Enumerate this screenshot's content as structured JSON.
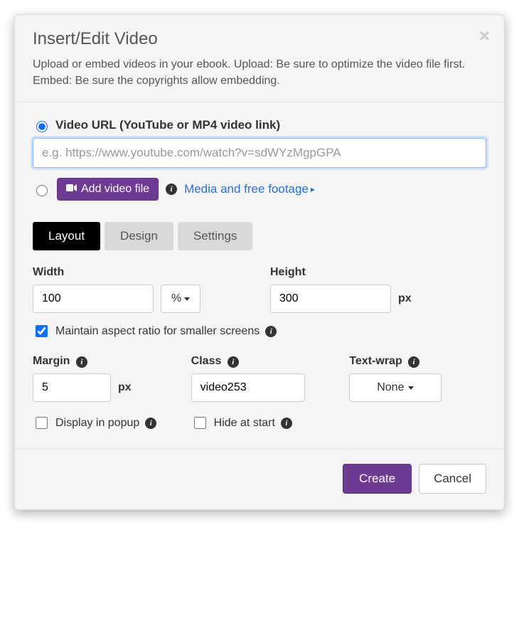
{
  "dialog": {
    "title": "Insert/Edit Video",
    "subtitle": "Upload or embed videos in your ebook. Upload: Be sure to optimize the video file first. Embed: Be sure the copyrights allow embedding."
  },
  "source": {
    "url_option_label": "Video URL (YouTube or MP4 video link)",
    "url_placeholder": "e.g. https://www.youtube.com/watch?v=sdWYzMgpGPA",
    "url_value": "",
    "add_file_label": "Add video file",
    "media_link": "Media and free footage"
  },
  "tabs": {
    "layout": "Layout",
    "design": "Design",
    "settings": "Settings"
  },
  "layout": {
    "width_label": "Width",
    "width_value": "100",
    "width_unit": "%",
    "height_label": "Height",
    "height_value": "300",
    "height_unit": "px",
    "aspect_label": "Maintain aspect ratio for smaller screens",
    "margin_label": "Margin",
    "margin_value": "5",
    "margin_unit": "px",
    "class_label": "Class",
    "class_value": "video253",
    "wrap_label": "Text-wrap",
    "wrap_value": "None",
    "popup_label": "Display in popup",
    "hide_label": "Hide at start"
  },
  "footer": {
    "create": "Create",
    "cancel": "Cancel"
  }
}
